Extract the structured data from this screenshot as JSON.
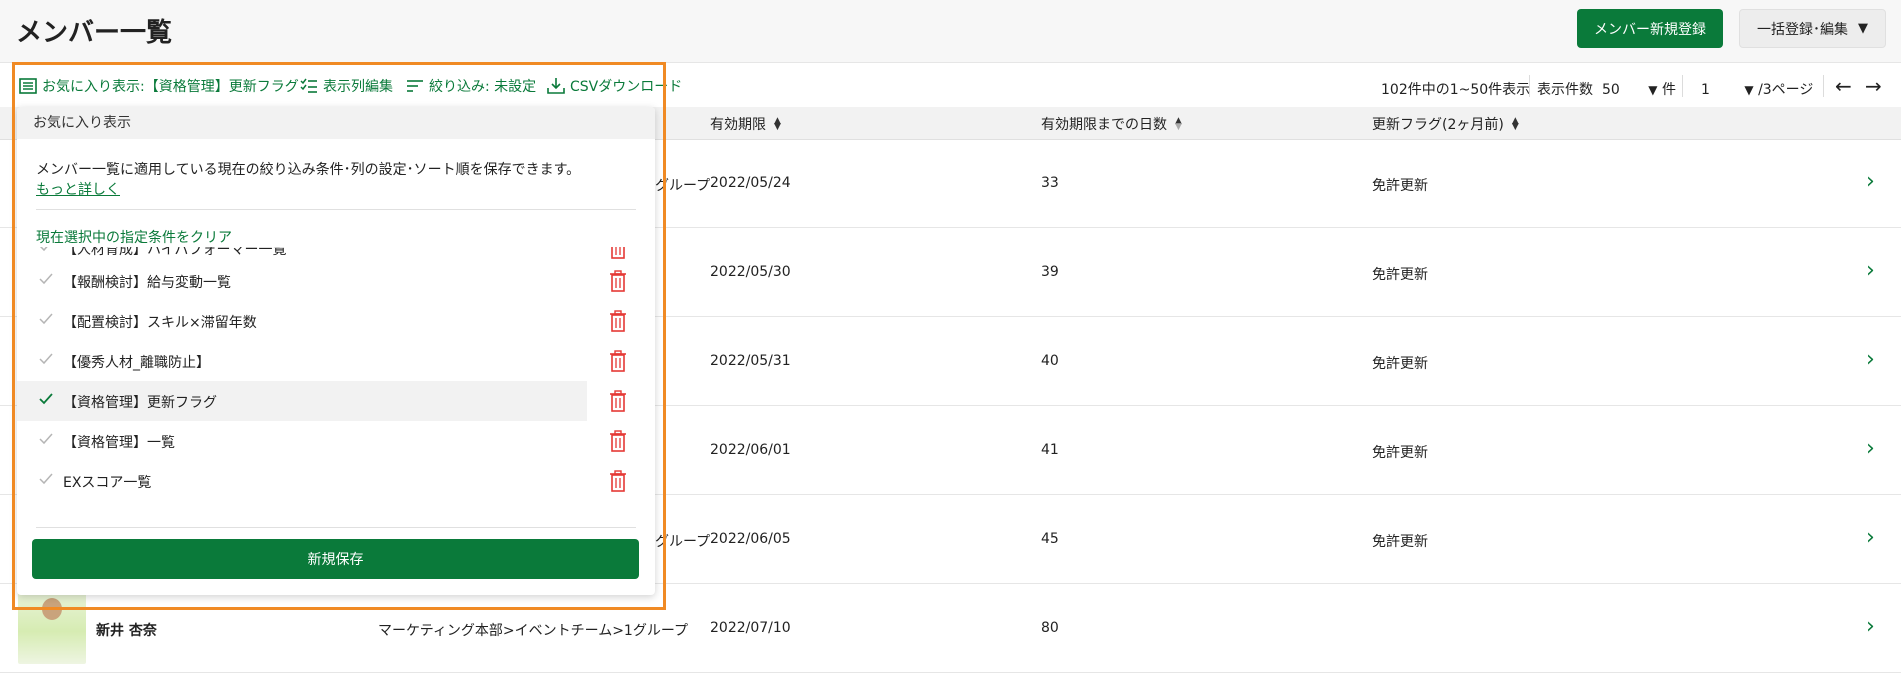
{
  "header": {
    "title": "メンバー一覧",
    "new_member_label": "メンバー新規登録",
    "bulk_label": "一括登録･編集"
  },
  "toolbar": {
    "favorite_label": "お気に入り表示:【資格管理】更新フラグ",
    "columns_label": "表示列編集",
    "filter_label": "絞り込み: 未設定",
    "csv_label": "CSVダウンロード",
    "count_text": "102件中の1~50件表示",
    "per_page_label": "表示件数",
    "per_page_value": "50",
    "per_page_unit": "件",
    "page_value": "1",
    "page_total": "/3ページ"
  },
  "table": {
    "columns": [
      "有効期限",
      "有効期限までの日数",
      "更新フラグ(2ヶ月前)"
    ],
    "rows": [
      {
        "dept_suffix": "グループ",
        "expiry": "2022/05/24",
        "days": "33",
        "flag": "免許更新"
      },
      {
        "dept_suffix": "",
        "expiry": "2022/05/30",
        "days": "39",
        "flag": "免許更新"
      },
      {
        "dept_suffix": "",
        "expiry": "2022/05/31",
        "days": "40",
        "flag": "免許更新"
      },
      {
        "dept_suffix": "",
        "expiry": "2022/06/01",
        "days": "41",
        "flag": "免許更新"
      },
      {
        "dept_suffix": "グループ",
        "expiry": "2022/06/05",
        "days": "45",
        "flag": "免許更新"
      },
      {
        "name": "新井 杏奈",
        "dept": "マーケティング本部>イベントチーム>1グループ",
        "expiry": "2022/07/10",
        "days": "80",
        "flag": ""
      }
    ]
  },
  "dropdown": {
    "header": "お気に入り表示",
    "description": "メンバー一覧に適用している現在の絞り込み条件･列の設定･ソート順を保存できます。",
    "more_link": "もっと詳しく",
    "clear_label": "現在選択中の指定条件をクリア",
    "items": [
      {
        "label": "【人材育成】ハイパフォーマー一覧",
        "selected": false
      },
      {
        "label": "【報酬検討】給与変動一覧",
        "selected": false
      },
      {
        "label": "【配置検討】スキル×滞留年数",
        "selected": false
      },
      {
        "label": "【優秀人材_離職防止】",
        "selected": false
      },
      {
        "label": "【資格管理】更新フラグ",
        "selected": true
      },
      {
        "label": "【資格管理】一覧",
        "selected": false
      },
      {
        "label": "EXスコア一覧",
        "selected": false
      }
    ],
    "save_label": "新規保存"
  },
  "colors": {
    "accent": "#0a7a3a",
    "highlight": "#f08a24",
    "danger": "#e53935"
  }
}
